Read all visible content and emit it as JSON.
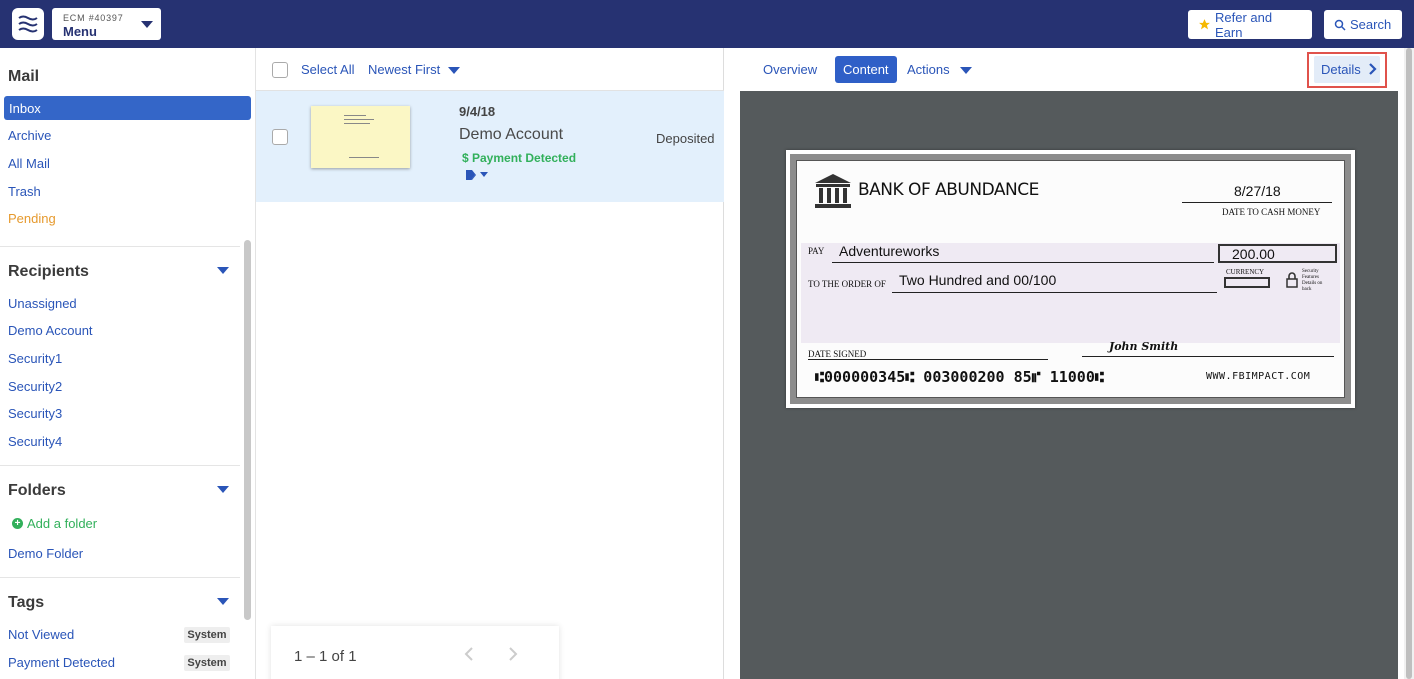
{
  "topbar": {
    "menu_small": "ECM #40397",
    "menu_big": "Menu",
    "refer_label": "Refer and Earn",
    "search_label": "Search"
  },
  "sidebar": {
    "mail_heading": "Mail",
    "mail_items": [
      "Inbox",
      "Archive",
      "All Mail",
      "Trash",
      "Pending"
    ],
    "recipients_heading": "Recipients",
    "recipients": [
      "Unassigned",
      "Demo Account",
      "Security1",
      "Security2",
      "Security3",
      "Security4"
    ],
    "folders_heading": "Folders",
    "add_folder": "Add a folder",
    "folders": [
      "Demo Folder"
    ],
    "tags_heading": "Tags",
    "tags": [
      {
        "label": "Not Viewed",
        "badge": "System"
      },
      {
        "label": "Payment Detected",
        "badge": "System"
      }
    ]
  },
  "list": {
    "select_all": "Select All",
    "sort": "Newest First",
    "item": {
      "date": "9/4/18",
      "name": "Demo Account",
      "payment": "$ Payment Detected",
      "status": "Deposited"
    },
    "pager": "1 – 1 of 1"
  },
  "detail": {
    "tabs": [
      "Overview",
      "Content",
      "Actions"
    ],
    "details_label": "Details"
  },
  "cheque": {
    "bank": "BANK OF ABUNDANCE",
    "date": "8/27/18",
    "date_label": "DATE TO CASH MONEY",
    "pay_label": "PAY",
    "payee": "Adventureworks",
    "amount": "200.00",
    "order_label": "TO THE ORDER OF",
    "written": "Two Hundred and 00/100",
    "currency_label": "CURRENCY",
    "security_label": "Security Features Details on back",
    "date_signed": "DATE SIGNED",
    "signature": "John Smith",
    "micr": "⑆000000345⑆  003000200 85⑈  11000⑆",
    "website": "WWW.FBIMPACT.COM"
  }
}
